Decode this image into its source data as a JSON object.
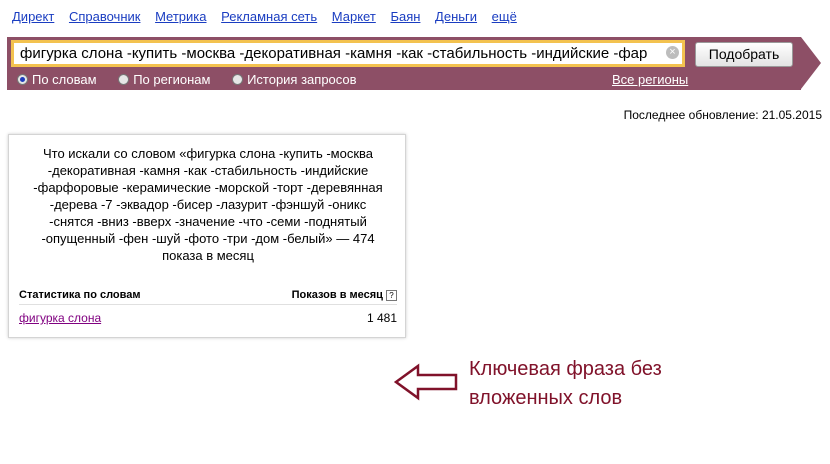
{
  "nav": {
    "items": [
      "Директ",
      "Справочник",
      "Метрика",
      "Рекламная сеть",
      "Маркет",
      "Баян",
      "Деньги",
      "ещё"
    ]
  },
  "search": {
    "query": "фигурка слона -купить -москва -декоративная -камня -как -стабильность -индийские -фар",
    "clear_icon": "×",
    "submit_label": "Подобрать",
    "options": [
      "По словам",
      "По регионам",
      "История запросов"
    ],
    "selected": "По словам",
    "regions_link": "Все регионы"
  },
  "last_update": "Последнее обновление: 21.05.2015",
  "results": {
    "title": "Что искали со словом «фигурка слона -купить -москва -декоративная -камня -как -стабильность -индийские -фарфоровые -керамические -морской -торт -деревянная -дерева -7 -эквадор -бисер -лазурит -фэншуй -оникс -снятся -вниз -вверх -значение -что -семи -поднятый -опущенный -фен -шуй -фото -три -дом -белый» — 474 показа в месяц",
    "col_words": "Статистика по словам",
    "col_shows": "Показов в месяц",
    "help": "?",
    "rows": [
      {
        "phrase": "фигурка слона",
        "count": "1 481"
      }
    ]
  },
  "annotation": {
    "line1": "Ключевая фраза без",
    "line2": "вложенных слов",
    "color": "#80122a"
  },
  "colors": {
    "bar": "#8d4f66",
    "link": "#1a3dc1",
    "visited": "#800080",
    "input_border": "#f3c24f"
  }
}
